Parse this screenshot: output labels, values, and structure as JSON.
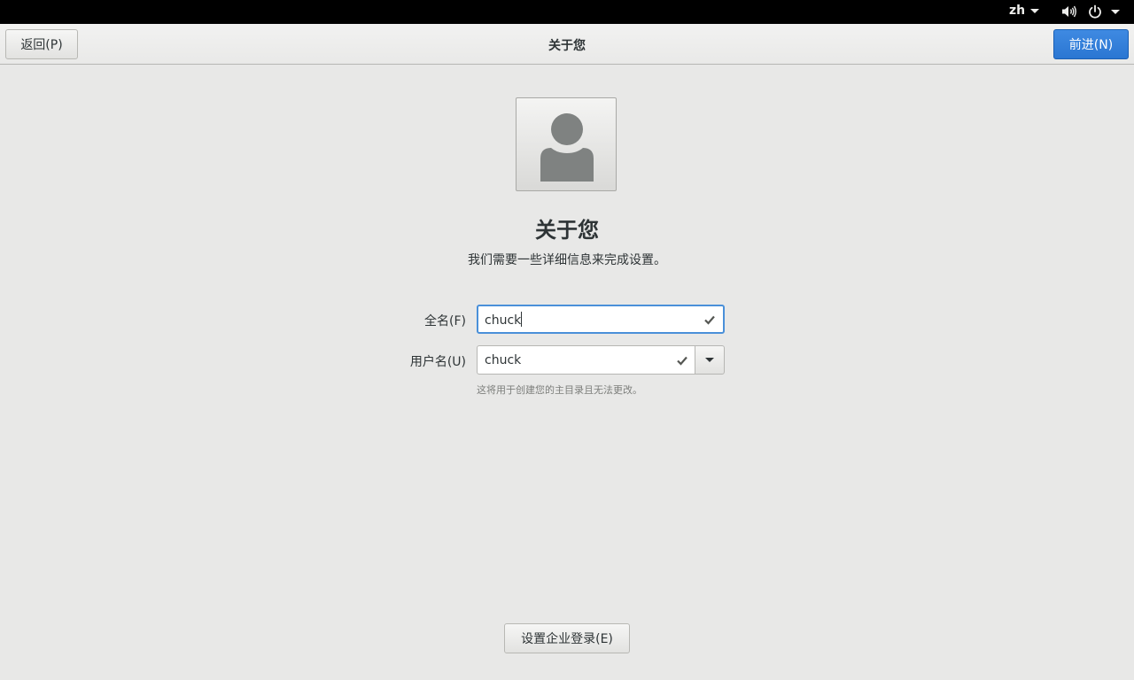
{
  "topbar": {
    "language": "zh",
    "icons": [
      "volume-icon",
      "power-icon",
      "system-menu-caret-icon"
    ]
  },
  "header": {
    "back_label": "返回(P)",
    "title": "关于您",
    "next_label": "前进(N)"
  },
  "content": {
    "avatar_icon": "user-avatar-icon",
    "heading": "关于您",
    "subtitle": "我们需要一些详细信息来完成设置。",
    "fullname": {
      "label": "全名(F)",
      "value": "chuck"
    },
    "username": {
      "label": "用户名(U)",
      "value": "chuck",
      "hint": "这将用于创建您的主目录且无法更改。"
    },
    "enterprise_login_label": "设置企业登录(E)"
  },
  "colors": {
    "accent": "#4a90d9",
    "suggested_action": "#3582dc",
    "topbar_bg": "#000000",
    "window_bg": "#e8e8e7"
  }
}
